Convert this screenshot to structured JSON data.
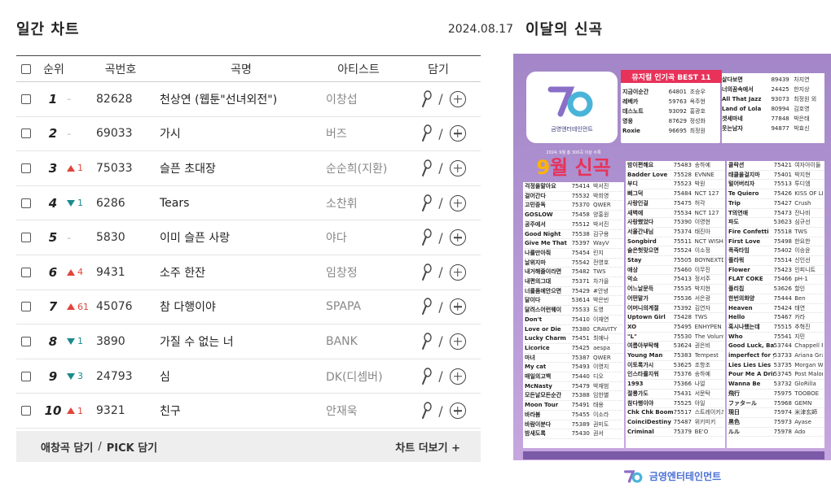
{
  "daily_chart": {
    "title": "일간 차트",
    "date": "2024.08.17",
    "headers": {
      "rank": "순위",
      "number": "곡번호",
      "title": "곡명",
      "artist": "아티스트",
      "save": "담기"
    },
    "rows": [
      {
        "rank": "1",
        "change": "–",
        "dir": "same",
        "number": "82628",
        "title": "천상연 (웹툰\"선녀외전\")",
        "artist": "이창섭"
      },
      {
        "rank": "2",
        "change": "–",
        "dir": "same",
        "number": "69033",
        "title": "가시",
        "artist": "버즈"
      },
      {
        "rank": "3",
        "change": "1",
        "dir": "up",
        "number": "75033",
        "title": "슬픈 초대장",
        "artist": "순순희(지환)"
      },
      {
        "rank": "4",
        "change": "1",
        "dir": "down",
        "number": "6286",
        "title": "Tears",
        "artist": "소찬휘"
      },
      {
        "rank": "5",
        "change": "–",
        "dir": "same",
        "number": "5830",
        "title": "이미 슬픈 사랑",
        "artist": "야다"
      },
      {
        "rank": "6",
        "change": "4",
        "dir": "up",
        "number": "9431",
        "title": "소주 한잔",
        "artist": "임창정"
      },
      {
        "rank": "7",
        "change": "61",
        "dir": "up",
        "number": "45076",
        "title": "참 다행이야",
        "artist": "SPAPA"
      },
      {
        "rank": "8",
        "change": "1",
        "dir": "down",
        "number": "3890",
        "title": "가질 수 없는 너",
        "artist": "BANK"
      },
      {
        "rank": "9",
        "change": "3",
        "dir": "down",
        "number": "24793",
        "title": "심",
        "artist": "DK(디셈버)"
      },
      {
        "rank": "10",
        "change": "1",
        "dir": "up",
        "number": "9321",
        "title": "친구",
        "artist": "안재욱"
      }
    ],
    "footer": {
      "favorite": "애창곡 담기",
      "separator": "/",
      "pick": "PICK 담기",
      "more": "차트 더보기 +"
    }
  },
  "monthly": {
    "title": "이달의 신곡",
    "poster": {
      "company": "금영엔터테인먼트",
      "best_title": "뮤지컬 인기곡 BEST 11",
      "best_left": [
        {
          "t": "지금이순간",
          "n": "64801",
          "a": "조승우"
        },
        {
          "t": "레베카",
          "n": "59763",
          "a": "옥주현"
        },
        {
          "t": "데스노트",
          "n": "93092",
          "a": "홍광호"
        },
        {
          "t": "영웅",
          "n": "87629",
          "a": "정성화"
        },
        {
          "t": "Roxie",
          "n": "96695",
          "a": "최정원"
        }
      ],
      "best_right": [
        {
          "t": "살다보면",
          "n": "89439",
          "a": "차지연"
        },
        {
          "t": "너의꿈속에서",
          "n": "24425",
          "a": "한지상"
        },
        {
          "t": "All That Jazz",
          "n": "93073",
          "a": "최정원 외"
        },
        {
          "t": "Land of Lola",
          "n": "80994",
          "a": "김호영"
        },
        {
          "t": "겟세마네",
          "n": "77848",
          "a": "박은태"
        },
        {
          "t": "웃는남자",
          "n": "94877",
          "a": "박효신"
        }
      ],
      "month_sub": "2024. 9월 총 300곡 이상 수록",
      "month_num": "9",
      "month_word": "월",
      "month_text": "신곡",
      "col1": [
        {
          "t": "걱정을말아요",
          "n": "75414",
          "a": "박서진"
        },
        {
          "t": "걸어간다",
          "n": "75532",
          "a": "박희영"
        },
        {
          "t": "고민중독",
          "n": "75370",
          "a": "QWER"
        },
        {
          "t": "GOSLOW",
          "n": "75458",
          "a": "양홍원"
        },
        {
          "t": "공주에서",
          "n": "75512",
          "a": "박서진"
        },
        {
          "t": "Good Night",
          "n": "75538",
          "a": "김구용"
        },
        {
          "t": "Give Me That",
          "n": "75397",
          "a": "WayV"
        },
        {
          "t": "나를만아줘",
          "n": "75454",
          "a": "린지"
        },
        {
          "t": "날위지마",
          "n": "75542",
          "a": "전영호"
        },
        {
          "t": "내거해줄이라면",
          "n": "75482",
          "a": "TWS"
        },
        {
          "t": "내편의그대",
          "n": "75371",
          "a": "차가을"
        },
        {
          "t": "너를품에안으면",
          "n": "75429",
          "a": "#안녕"
        },
        {
          "t": "달이다",
          "n": "53614",
          "a": "박은빈"
        },
        {
          "t": "달려스어런웨이",
          "n": "75533",
          "a": "도영"
        },
        {
          "t": "Don't",
          "n": "75410",
          "a": "이재연"
        },
        {
          "t": "Love or Die",
          "n": "75380",
          "a": "CRAVITY"
        },
        {
          "t": "Lucky Charm",
          "n": "75451",
          "a": "최예나"
        },
        {
          "t": "Licorice",
          "n": "75425",
          "a": "aespa"
        },
        {
          "t": "마녀",
          "n": "75387",
          "a": "QWER"
        },
        {
          "t": "My cat",
          "n": "75493",
          "a": "이영지"
        },
        {
          "t": "매일의고백",
          "n": "75440",
          "a": "디오"
        },
        {
          "t": "McNasty",
          "n": "75479",
          "a": "박재범"
        },
        {
          "t": "모든날모든순간",
          "n": "75388",
          "a": "임한별"
        },
        {
          "t": "Moon Tour",
          "n": "75491",
          "a": "태용"
        },
        {
          "t": "바라봄",
          "n": "75455",
          "a": "이소라"
        },
        {
          "t": "바람이분다",
          "n": "75389",
          "a": "권미도"
        },
        {
          "t": "밤새도록",
          "n": "75430",
          "a": "권서"
        }
      ],
      "col2": [
        {
          "t": "밤이편해요",
          "n": "75483",
          "a": "송하예"
        },
        {
          "t": "Badder Love",
          "n": "75528",
          "a": "EVNNE"
        },
        {
          "t": "부디",
          "n": "75523",
          "a": "박원"
        },
        {
          "t": "삐그덕",
          "n": "75484",
          "a": "NCT 127"
        },
        {
          "t": "사랑인걸",
          "n": "75475",
          "a": "허각"
        },
        {
          "t": "새벽에",
          "n": "75534",
          "a": "NCT 127"
        },
        {
          "t": "사랑했었다",
          "n": "75390",
          "a": "이영현"
        },
        {
          "t": "서울간내님",
          "n": "75374",
          "a": "태진아"
        },
        {
          "t": "Songbird",
          "n": "75511",
          "a": "NCT WISH"
        },
        {
          "t": "술은헛맞으면",
          "n": "75524",
          "a": "이소정"
        },
        {
          "t": "Stay",
          "n": "75505",
          "a": "BOYNEXTDOOR"
        },
        {
          "t": "애상",
          "n": "75460",
          "a": "이무진"
        },
        {
          "t": "악쇼",
          "n": "75413",
          "a": "정서주"
        },
        {
          "t": "어느날문득",
          "n": "75535",
          "a": "박지현"
        },
        {
          "t": "어떤말가",
          "n": "75536",
          "a": "서은광"
        },
        {
          "t": "어머니의계절",
          "n": "75392",
          "a": "김연자"
        },
        {
          "t": "Uptown Girl",
          "n": "75428",
          "a": "TWS"
        },
        {
          "t": "XO",
          "n": "75495",
          "a": "ENHYPEN"
        },
        {
          "t": "\"L\"",
          "n": "75530",
          "a": "The Volunteers"
        },
        {
          "t": "여름아부탁해",
          "n": "53624",
          "a": "권은비"
        },
        {
          "t": "Young Man",
          "n": "75383",
          "a": "Tempest"
        },
        {
          "t": "이토록가시",
          "n": "53625",
          "a": "조항조"
        },
        {
          "t": "인스타를지워",
          "n": "75376",
          "a": "송하예"
        },
        {
          "t": "1993",
          "n": "75366",
          "a": "나얼"
        },
        {
          "t": "절룡가도",
          "n": "75431",
          "a": "서문탁"
        },
        {
          "t": "참다행이야",
          "n": "75525",
          "a": "아일"
        },
        {
          "t": "Chk Chk Boom",
          "n": "75517",
          "a": "스트레이키즈"
        },
        {
          "t": "CoinciDestiny",
          "n": "75487",
          "a": "위키미키"
        },
        {
          "t": "Criminal",
          "n": "75379",
          "a": "BE'O"
        }
      ],
      "col3": [
        {
          "t": "클락션",
          "n": "75421",
          "a": "여자아이들"
        },
        {
          "t": "태클을걸지마",
          "n": "75401",
          "a": "박지현"
        },
        {
          "t": "털어버리자",
          "n": "75513",
          "a": "투디엠"
        },
        {
          "t": "Te Quiero",
          "n": "75426",
          "a": "KISS OF LIFE"
        },
        {
          "t": "Trip",
          "n": "75427",
          "a": "Crush"
        },
        {
          "t": "T의연애",
          "n": "75473",
          "a": "잔나비"
        },
        {
          "t": "파도",
          "n": "53623",
          "a": "심규선"
        },
        {
          "t": "Fire Confetti",
          "n": "75518",
          "a": "TWS"
        },
        {
          "t": "First Love",
          "n": "75498",
          "a": "한요한"
        },
        {
          "t": "폭죽타임",
          "n": "75402",
          "a": "이승윤"
        },
        {
          "t": "플라워",
          "n": "75514",
          "a": "신인선"
        },
        {
          "t": "Flower",
          "n": "75423",
          "a": "인피니트"
        },
        {
          "t": "FLAT COKE",
          "n": "75466",
          "a": "pH-1"
        },
        {
          "t": "플리칩",
          "n": "53626",
          "a": "할인"
        },
        {
          "t": "한번의화양",
          "n": "75444",
          "a": "Ben"
        },
        {
          "t": "Heaven",
          "n": "75424",
          "a": "태연"
        },
        {
          "t": "Hello",
          "n": "75467",
          "a": "카라"
        },
        {
          "t": "혹시나했는데",
          "n": "75515",
          "a": "추혁진"
        },
        {
          "t": "Who",
          "n": "75541",
          "a": "지민"
        },
        {
          "t": "Good Luck, Babe!",
          "n": "53744",
          "a": "Chappell Roan"
        },
        {
          "t": "imperfect for you",
          "n": "53733",
          "a": "Ariana Grande"
        },
        {
          "t": "Lies Lies Lies",
          "n": "53735",
          "a": "Morgan Wallen"
        },
        {
          "t": "Pour Me A Drink",
          "n": "53745",
          "a": "Post Malone"
        },
        {
          "t": "Wanna Be",
          "n": "53732",
          "a": "GloRilla"
        },
        {
          "t": "飛行",
          "n": "75975",
          "a": "TOOBOE"
        },
        {
          "t": "ファタール",
          "n": "75968",
          "a": "GEMN"
        },
        {
          "t": "現日",
          "n": "75974",
          "a": "米津玄師"
        },
        {
          "t": "黒色",
          "n": "75973",
          "a": "Ayase"
        },
        {
          "t": "ルル",
          "n": "75978",
          "a": "Ado"
        }
      ]
    }
  },
  "colors": {
    "up": "#e0453b",
    "down": "#1b8a8c",
    "poster_bg": "#a386c7",
    "accent_pink": "#e8325a",
    "accent_yellow": "#ffb400"
  }
}
